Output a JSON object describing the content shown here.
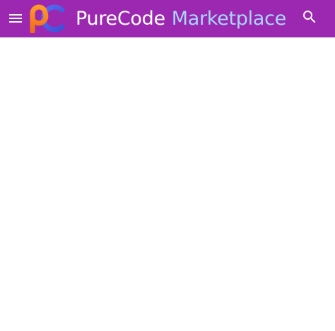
{
  "header": {
    "brand_word_1": "PureCode",
    "brand_word_2": "Marketplace",
    "background_color": "#9c27b0",
    "menu_icon": "hamburger-menu-icon",
    "search_icon": "search-icon",
    "logo": "purecode-logo"
  }
}
